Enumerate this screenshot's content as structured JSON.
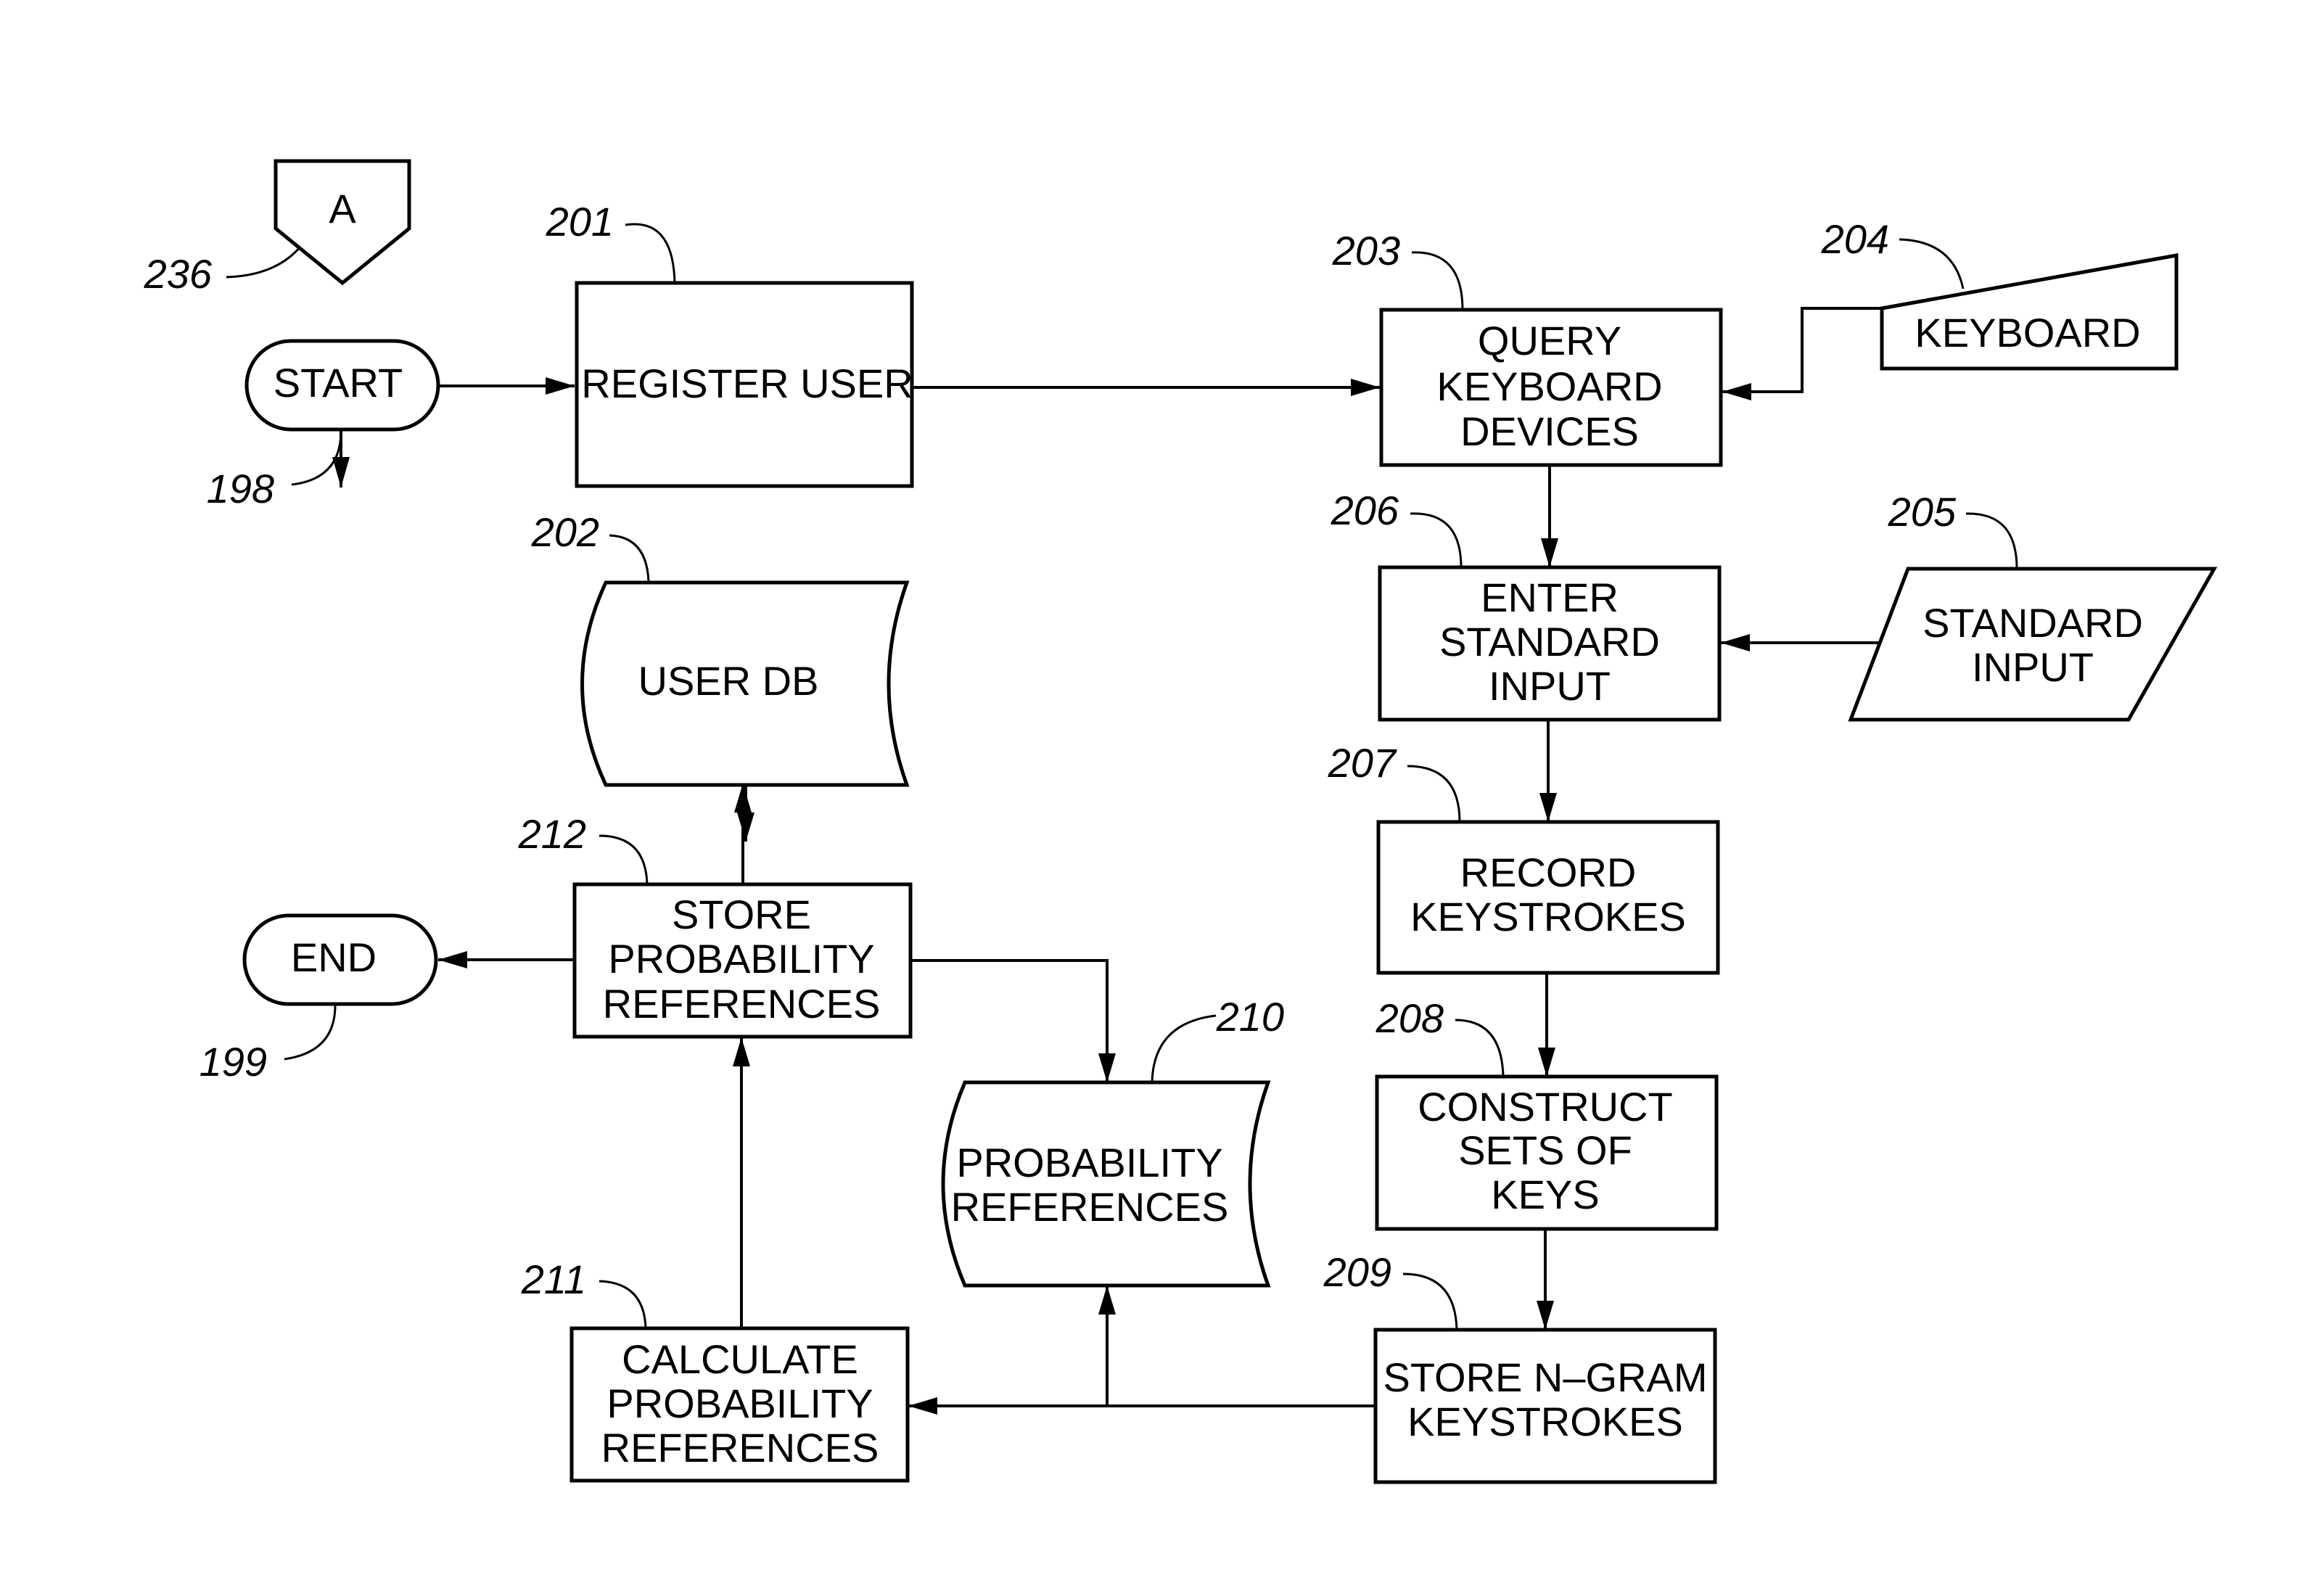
{
  "figure": {
    "type": "flowchart",
    "nodes": {
      "connector_a": {
        "ref": "236",
        "label": [
          "A"
        ],
        "shape": "off-page-connector"
      },
      "start": {
        "ref": "198",
        "label": [
          "START"
        ],
        "shape": "terminator"
      },
      "register_user": {
        "ref": "201",
        "label": [
          "REGISTER  USER"
        ],
        "shape": "process"
      },
      "user_db": {
        "ref": "202",
        "label": [
          "USER  DB"
        ],
        "shape": "stored-data"
      },
      "query_keyboard": {
        "ref": "203",
        "label": [
          "QUERY",
          "KEYBOARD",
          "DEVICES"
        ],
        "shape": "process"
      },
      "keyboard": {
        "ref": "204",
        "label": [
          "KEYBOARD"
        ],
        "shape": "manual-input"
      },
      "standard_input": {
        "ref": "205",
        "label": [
          "STANDARD",
          "INPUT"
        ],
        "shape": "data-io"
      },
      "enter_standard_input": {
        "ref": "206",
        "label": [
          "ENTER",
          "STANDARD",
          "INPUT"
        ],
        "shape": "process"
      },
      "record_keystrokes": {
        "ref": "207",
        "label": [
          "RECORD",
          "KEYSTROKES"
        ],
        "shape": "process"
      },
      "construct_sets": {
        "ref": "208",
        "label": [
          "CONSTRUCT",
          "SETS  OF",
          "KEYS"
        ],
        "shape": "process"
      },
      "store_ngram": {
        "ref": "209",
        "label": [
          "STORE  N–GRAM",
          "KEYSTROKES"
        ],
        "shape": "process"
      },
      "probability_references_db": {
        "ref": "210",
        "label": [
          "PROBABILITY",
          "REFERENCES"
        ],
        "shape": "stored-data"
      },
      "calculate_probability": {
        "ref": "211",
        "label": [
          "CALCULATE",
          "PROBABILITY",
          "REFERENCES"
        ],
        "shape": "process"
      },
      "store_probability": {
        "ref": "212",
        "label": [
          "STORE",
          "PROBABILITY",
          "REFERENCES"
        ],
        "shape": "process"
      },
      "end": {
        "ref": "199",
        "label": [
          "END"
        ],
        "shape": "terminator"
      }
    },
    "edges": [
      {
        "from": "connector_a",
        "to": "start"
      },
      {
        "from": "start",
        "to": "register_user"
      },
      {
        "from": "register_user",
        "to": "query_keyboard"
      },
      {
        "from": "register_user",
        "to": "user_db"
      },
      {
        "from": "keyboard",
        "to": "query_keyboard"
      },
      {
        "from": "query_keyboard",
        "to": "enter_standard_input"
      },
      {
        "from": "standard_input",
        "to": "enter_standard_input"
      },
      {
        "from": "enter_standard_input",
        "to": "record_keystrokes"
      },
      {
        "from": "record_keystrokes",
        "to": "construct_sets"
      },
      {
        "from": "construct_sets",
        "to": "store_ngram"
      },
      {
        "from": "store_ngram",
        "to": "calculate_probability"
      },
      {
        "from": "store_ngram",
        "to": "probability_references_db"
      },
      {
        "from": "calculate_probability",
        "to": "store_probability"
      },
      {
        "from": "store_probability",
        "to": "user_db"
      },
      {
        "from": "store_probability",
        "to": "probability_references_db"
      },
      {
        "from": "store_probability",
        "to": "end"
      }
    ]
  }
}
